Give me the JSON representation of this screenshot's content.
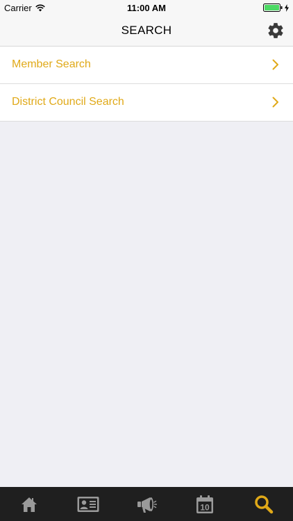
{
  "status_bar": {
    "carrier": "Carrier",
    "time": "11:00 AM"
  },
  "nav": {
    "title": "SEARCH",
    "settings_icon": "gear-icon"
  },
  "list": {
    "items": [
      {
        "label": "Member Search"
      },
      {
        "label": "District Council Search"
      }
    ]
  },
  "tabs": [
    {
      "icon": "home-icon",
      "active": false
    },
    {
      "icon": "id-card-icon",
      "active": false
    },
    {
      "icon": "megaphone-icon",
      "active": false
    },
    {
      "icon": "calendar-icon",
      "active": false,
      "badge_text": "10"
    },
    {
      "icon": "search-icon",
      "active": true
    }
  ],
  "colors": {
    "accent": "#e0a918",
    "tab_icon": "#9a9a9a",
    "tab_bar_bg": "#1f1f1f",
    "background": "#efeff4"
  }
}
